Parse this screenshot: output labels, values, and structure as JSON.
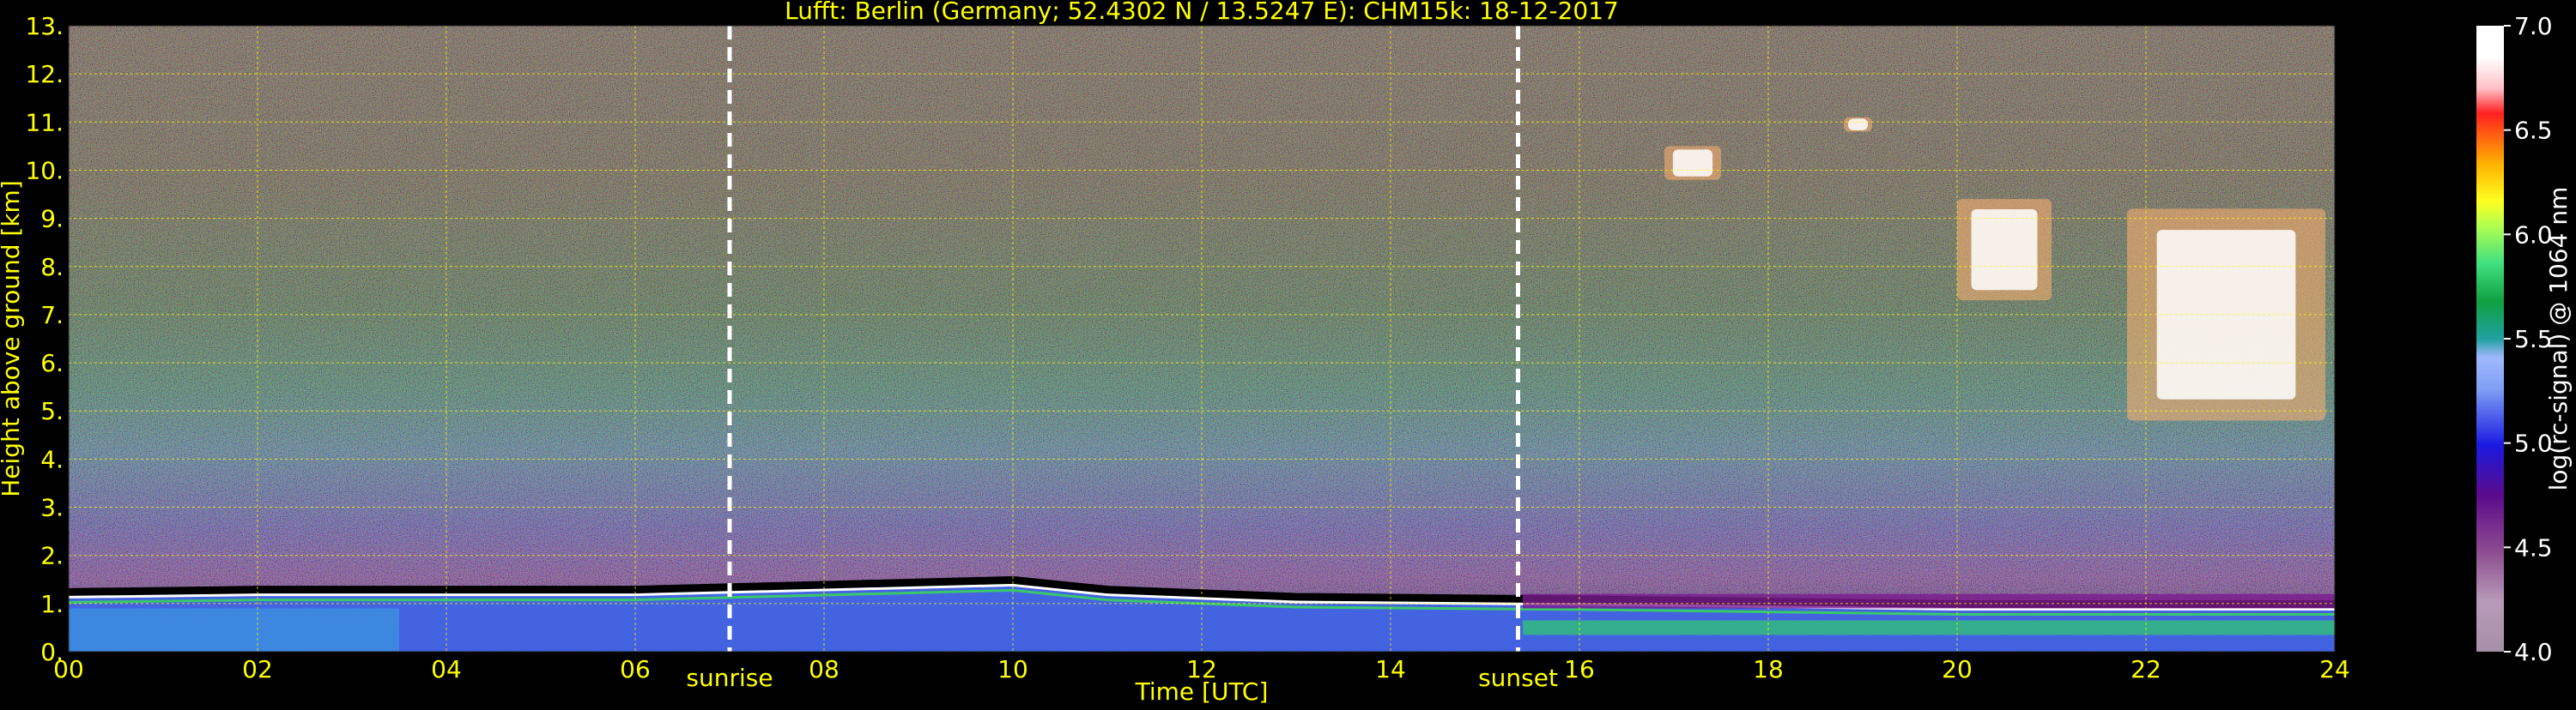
{
  "chart_data": {
    "type": "heatmap",
    "title": "Lufft: Berlin (Germany; 52.4302 N / 13.5247 E):    CHM15k: 18-12-2017",
    "xlabel": "Time [UTC]",
    "ylabel": "Height above ground [km]",
    "colorbar_label": "log(rc-signal) @ 1064 nm",
    "xlim": [
      0,
      24
    ],
    "ylim": [
      0,
      13
    ],
    "x_ticks": [
      "00",
      "02",
      "04",
      "06",
      "08",
      "10",
      "12",
      "14",
      "16",
      "18",
      "20",
      "22",
      "24"
    ],
    "y_ticks": [
      "0.",
      "1.",
      "2.",
      "3.",
      "4.",
      "5.",
      "6.",
      "7.",
      "8.",
      "9.",
      "10.",
      "11.",
      "12.",
      "13."
    ],
    "colorbar_range": [
      4.0,
      7.0
    ],
    "colorbar_ticks": [
      "4.0",
      "4.5",
      "5.0",
      "5.5",
      "6.0",
      "6.5",
      "7.0"
    ],
    "grid": true,
    "events": [
      {
        "label": "sunrise",
        "time": 7.0
      },
      {
        "label": "sunset",
        "time": 15.35
      }
    ],
    "boundary_layer_top_km": [
      {
        "t": 0.0,
        "h": 1.15
      },
      {
        "t": 2.0,
        "h": 1.2
      },
      {
        "t": 4.0,
        "h": 1.2
      },
      {
        "t": 6.0,
        "h": 1.2
      },
      {
        "t": 8.0,
        "h": 1.3
      },
      {
        "t": 10.0,
        "h": 1.4
      },
      {
        "t": 11.0,
        "h": 1.2
      },
      {
        "t": 13.0,
        "h": 1.05
      },
      {
        "t": 16.0,
        "h": 1.0
      },
      {
        "t": 20.0,
        "h": 0.9
      },
      {
        "t": 24.0,
        "h": 0.9
      }
    ],
    "clouds": [
      {
        "t_start": 16.9,
        "t_end": 17.5,
        "h_low_km": 9.8,
        "h_high_km": 10.5
      },
      {
        "t_start": 18.8,
        "t_end": 19.1,
        "h_low_km": 10.8,
        "h_high_km": 11.1
      },
      {
        "t_start": 20.0,
        "t_end": 21.0,
        "h_low_km": 7.3,
        "h_high_km": 9.4
      },
      {
        "t_start": 21.8,
        "t_end": 23.9,
        "h_low_km": 4.8,
        "h_high_km": 9.2
      }
    ]
  },
  "colors": {
    "axis_text": "#ffff00",
    "grid": "#ffff00",
    "background": "#000000",
    "colorbar_text": "#ffffff"
  }
}
